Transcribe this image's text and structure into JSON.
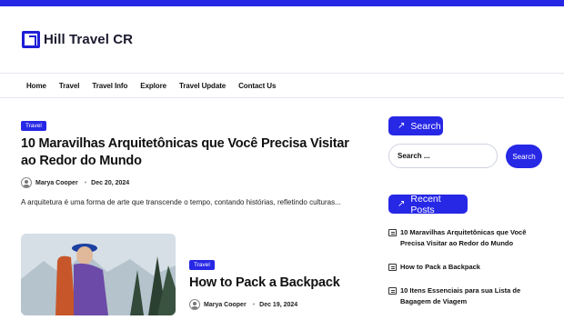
{
  "site": {
    "title": "Hill Travel CR"
  },
  "nav": {
    "items": [
      "Home",
      "Travel",
      "Travel Info",
      "Explore",
      "Travel Update",
      "Contact Us"
    ]
  },
  "posts": [
    {
      "category": "Travel",
      "title": "10 Maravilhas Arquitetônicas que Você Precisa Visitar ao Redor do Mundo",
      "author": "Marya Cooper",
      "date": "Dec 20, 2024",
      "excerpt": "A arquitetura é uma forma de arte que transcende o tempo, contando histórias, refletindo culturas..."
    },
    {
      "category": "Travel",
      "title": "How to Pack a Backpack",
      "author": "Marya Cooper",
      "date": "Dec 19, 2024"
    }
  ],
  "sidebar": {
    "search": {
      "heading": "Search",
      "placeholder": "Search ...",
      "button": "Search"
    },
    "recent": {
      "heading": "Recent Posts",
      "items": [
        "10 Maravilhas Arquitetônicas que Você Precisa Visitar ao Redor do Mundo",
        "How to Pack a Backpack",
        "10 Itens Essenciais para sua Lista de Bagagem de Viagem"
      ]
    }
  },
  "colors": {
    "accent": "#2727e6"
  }
}
